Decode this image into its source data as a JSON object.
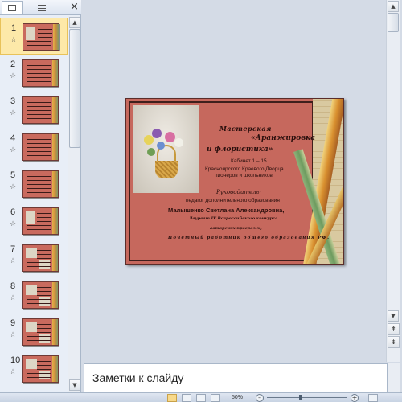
{
  "panel": {
    "tabs": [
      {
        "name": "slides-tab-icon"
      },
      {
        "name": "outline-tab-icon"
      }
    ],
    "close_glyph": "×",
    "slides": [
      {
        "number": "1",
        "transition_icon": "☆"
      },
      {
        "number": "2",
        "transition_icon": "☆"
      },
      {
        "number": "3",
        "transition_icon": "☆"
      },
      {
        "number": "4",
        "transition_icon": "☆"
      },
      {
        "number": "5",
        "transition_icon": "☆"
      },
      {
        "number": "6",
        "transition_icon": "☆"
      },
      {
        "number": "7",
        "transition_icon": "☆"
      },
      {
        "number": "8",
        "transition_icon": "☆"
      },
      {
        "number": "9",
        "transition_icon": "☆"
      },
      {
        "number": "10",
        "transition_icon": "☆"
      }
    ],
    "selected_slide": 1
  },
  "slide": {
    "title_line1": "Мастерская",
    "title_line2": "«Аранжировка",
    "title_line3": "и флористика»",
    "cabinet": "Кабинет 1 – 15",
    "palace_line1": "Красноярского Краевого Дворца",
    "palace_line2": "пионеров и школьников",
    "leader_label": "Руководитель:",
    "leader_role": "педагог дополнительного образования",
    "leader_name": "Малышенко Светлана Александровна,",
    "note1": "Лауреат IV Всероссийского конкурса",
    "note2": "авторских программ,",
    "note3": "Почетный работник общего образования РФ.",
    "colors": {
      "background": "#c6685d",
      "text": "#2a0f0d"
    }
  },
  "notes": {
    "placeholder": "Заметки к слайду"
  },
  "scroll": {
    "up_glyph": "▲",
    "down_glyph": "▼",
    "prev_slide_glyph": "⇞",
    "next_slide_glyph": "⇟"
  },
  "status": {
    "zoom_minus": "–",
    "zoom_plus": "+",
    "zoom_level_visible": "50%"
  }
}
